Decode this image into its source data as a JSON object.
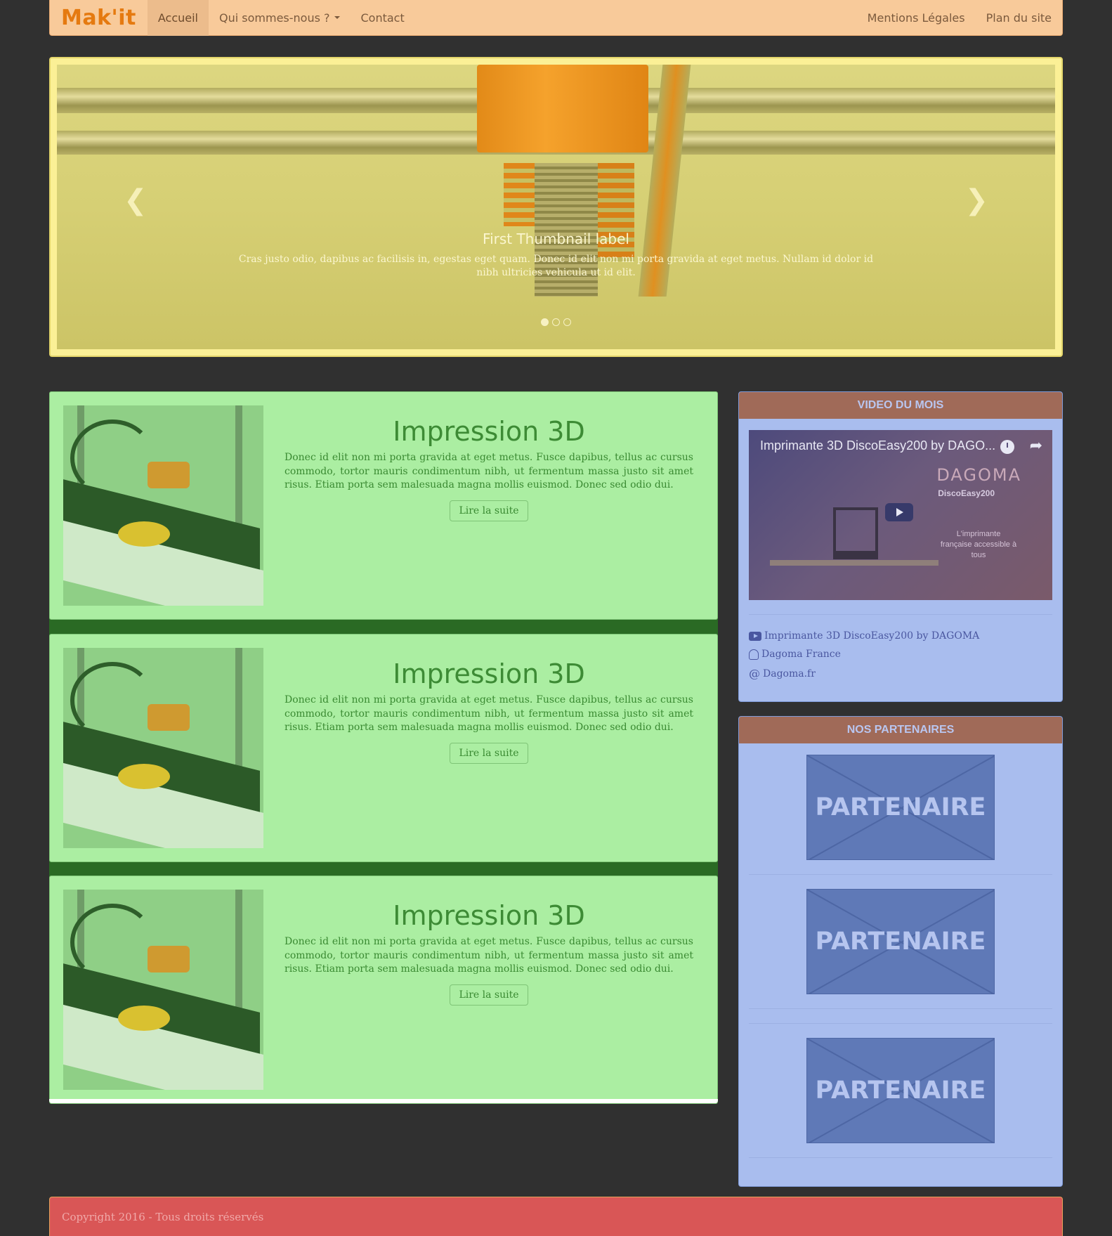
{
  "navbar": {
    "brand": "Mak'it",
    "items": [
      {
        "label": "Accueil",
        "active": true
      },
      {
        "label": "Qui sommes-nous ?",
        "dropdown": true
      },
      {
        "label": "Contact"
      }
    ],
    "right_items": [
      {
        "label": "Mentions Légales"
      },
      {
        "label": "Plan du site"
      }
    ]
  },
  "carousel": {
    "caption_title": "First Thumbnail label",
    "caption_text": "Cras justo odio, dapibus ac facilisis in, egestas eget quam. Donec id elit non mi porta gravida at eget metus. Nullam id dolor id nibh ultricies vehicula ut id elit.",
    "slides_count": 3,
    "active_slide": 1,
    "prev_icon": "chevron-left-icon",
    "next_icon": "chevron-right-icon"
  },
  "articles": [
    {
      "title": "Impression 3D",
      "text": "Donec id elit non mi porta gravida at eget metus. Fusce dapibus, tellus ac cursus commodo, tortor mauris condimentum nibh, ut fermentum massa justo sit amet risus. Etiam porta sem malesuada magna mollis euismod. Donec sed odio dui.",
      "button": "Lire la suite"
    },
    {
      "title": "Impression 3D",
      "text": "Donec id elit non mi porta gravida at eget metus. Fusce dapibus, tellus ac cursus commodo, tortor mauris condimentum nibh, ut fermentum massa justo sit amet risus. Etiam porta sem malesuada magna mollis euismod. Donec sed odio dui.",
      "button": "Lire la suite"
    },
    {
      "title": "Impression 3D",
      "text": "Donec id elit non mi porta gravida at eget metus. Fusce dapibus, tellus ac cursus commodo, tortor mauris condimentum nibh, ut fermentum massa justo sit amet risus. Etiam porta sem malesuada magna mollis euismod. Donec sed odio dui.",
      "button": "Lire la suite"
    }
  ],
  "video_panel": {
    "heading": "VIDEO DU MOIS",
    "video_title": "Imprimante 3D DiscoEasy200 by DAGO...",
    "brand_overlay": "DAGOMA",
    "product_overlay": "DiscoEasy200",
    "tagline_overlay": "L'imprimante française accessible à tous",
    "links": [
      {
        "icon": "youtube-icon",
        "label": "Imprimante 3D DiscoEasy200 by DAGOMA"
      },
      {
        "icon": "user-icon",
        "label": "Dagoma France"
      },
      {
        "icon": "at-icon",
        "label": "Dagoma.fr"
      }
    ]
  },
  "partners_panel": {
    "heading": "NOS PARTENAIRES",
    "partners": [
      {
        "label": "PARTENAIRE"
      },
      {
        "label": "PARTENAIRE"
      },
      {
        "label": "PARTENAIRE"
      }
    ]
  },
  "footer": {
    "copyright": "Copyright 2016 - Tous droits réservés"
  },
  "colors": {
    "navbar_bg": "#f8ca9a",
    "brand": "#e57a10",
    "carousel_bg": "#fbf096",
    "article_bg": "#abeea2",
    "sidebar_bg": "#a9bdee",
    "panel_heading_bg": "#a06a58",
    "footer_bg": "#d95656"
  }
}
